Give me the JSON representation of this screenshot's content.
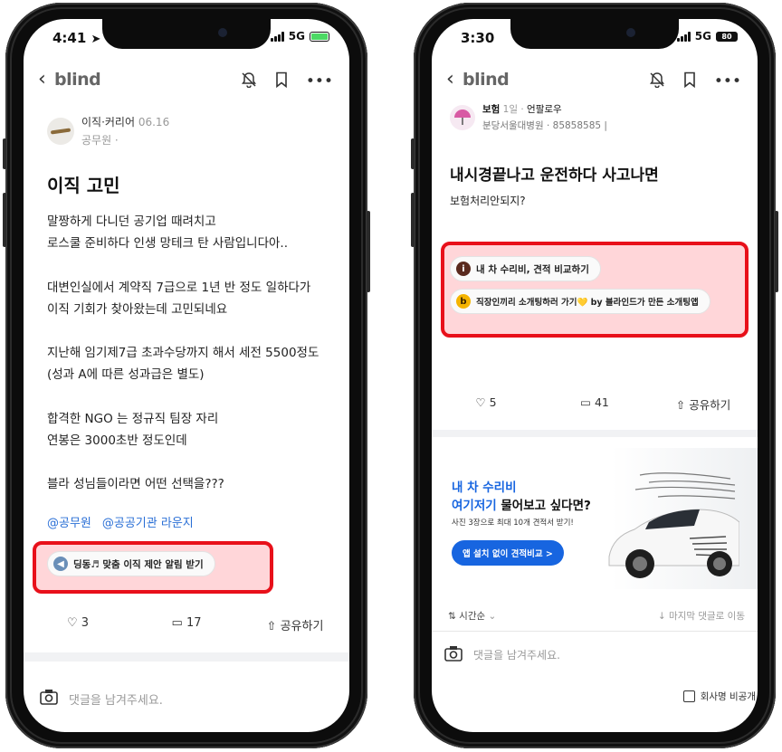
{
  "left": {
    "status": {
      "time": "4:41",
      "network": "5G"
    },
    "nav": {
      "brand": "blind"
    },
    "post": {
      "category": "이직·커리어",
      "date": "06.16",
      "company": "공무원 ·",
      "title": "이직 고민",
      "body": [
        "말짱하게 다니던 공기업 때려치고",
        "로스쿨 준비하다 인생 망테크 탄 사람입니다아..",
        "",
        "대변인실에서 계약직 7급으로 1년 반 정도 일하다가",
        "이직 기회가 찾아왔는데 고민되네요",
        "",
        "지난해 임기제7급 초과수당까지 해서 세전 5500정도",
        "(성과 A에 따른 성과급은 별도)",
        "",
        "합격한 NGO 는 정규직 팀장 자리",
        "연봉은 3000초반 정도인데",
        "",
        "블라 성님들이라면 어떤 선택을???"
      ],
      "tags": [
        "@공무원",
        "@공공기관 라운지"
      ],
      "promo_chip": "딩동♬ 맞춤 이직 제안 알림 받기",
      "likes": "3",
      "comments": "17",
      "share": "공유하기",
      "comment_placeholder": "댓글을 남겨주세요."
    }
  },
  "right": {
    "status": {
      "time": "3:30",
      "network": "5G",
      "battery": "80"
    },
    "nav": {
      "brand": "blind"
    },
    "post": {
      "category": "보험",
      "time_ago": "1일",
      "author": "언팔로우",
      "company": "분당서울대병원 · 85858585 |",
      "title": "내시경끝나고 운전하다 사고나면",
      "body": "보험처리안되지?",
      "chip1": "내 차 수리비, 견적 비교하기",
      "chip2": "직장인끼리 소개팅하러 가기💛 by 블라인드가 만든 소개팅앱",
      "likes": "5",
      "comments": "41",
      "share": "공유하기"
    },
    "ad": {
      "line1": "내 차 수리비",
      "line2_highlight": "여기저기",
      "line2_rest": " 물어보고 싶다면?",
      "sub": "사진 3장으로 최대 10개 견적서 받기!",
      "button": "앱 설치 없이 견적비교 >"
    },
    "comments_bar": {
      "sort": "시간순",
      "jump": "↓ 마지막 댓글로 이동"
    },
    "comment_placeholder": "댓글을 남겨주세요.",
    "company_hide": "회사명 비공개"
  },
  "colors": {
    "highlight_border": "#e8101a",
    "highlight_fill": "#ffb4b9",
    "tag_blue": "#2a6fd6",
    "ad_blue": "#1765e0",
    "chip_yellow": "#f5b400",
    "chip_brown": "#5a2a1e"
  }
}
